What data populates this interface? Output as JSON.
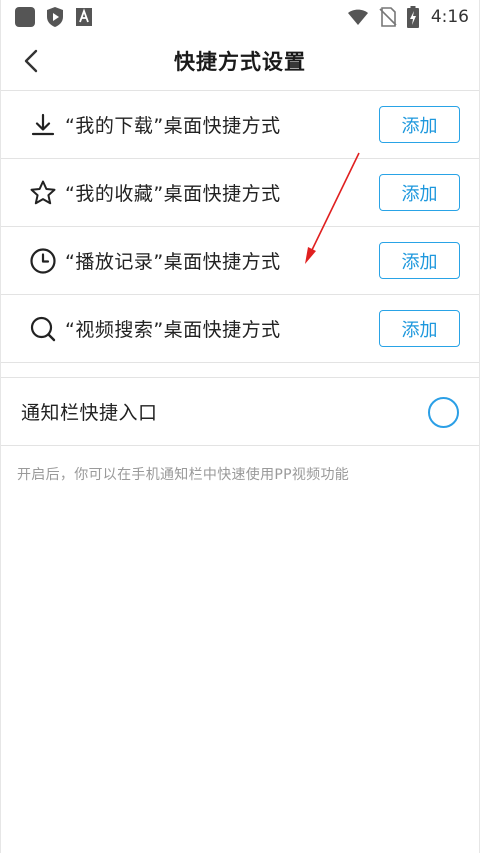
{
  "status_bar": {
    "time": "4:16",
    "icons": [
      "square-app-icon",
      "shield-play-icon",
      "a-box-icon",
      "wifi-icon",
      "no-sim-icon",
      "battery-charging-icon"
    ]
  },
  "header": {
    "title": "快捷方式设置",
    "back_icon": "chevron-left-icon"
  },
  "shortcuts": [
    {
      "icon": "download-icon",
      "label": "“我的下载”桌面快捷方式",
      "button": "添加"
    },
    {
      "icon": "star-icon",
      "label": "“我的收藏”桌面快捷方式",
      "button": "添加"
    },
    {
      "icon": "clock-icon",
      "label": "“播放记录”桌面快捷方式",
      "button": "添加"
    },
    {
      "icon": "search-icon",
      "label": "“视频搜索”桌面快捷方式",
      "button": "添加"
    }
  ],
  "notification": {
    "label": "通知栏快捷入口",
    "toggle_on": false,
    "hint": "开启后，你可以在手机通知栏中快速使用PP视频功能"
  },
  "colors": {
    "accent": "#1e98dd",
    "annotation_arrow": "#e02020",
    "divider": "#e3e3e3",
    "hint_text": "#9a9a9a"
  }
}
